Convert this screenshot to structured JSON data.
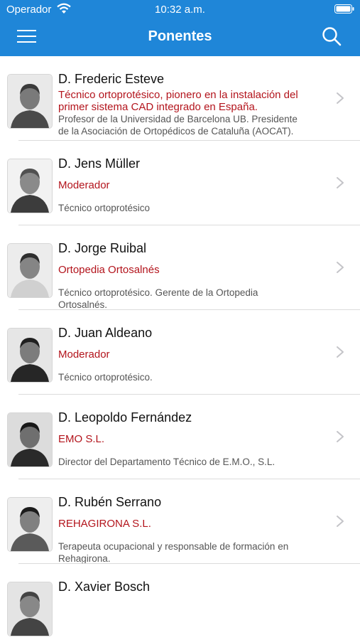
{
  "status_bar": {
    "carrier": "Operador",
    "time": "10:32 a.m."
  },
  "nav": {
    "title": "Ponentes"
  },
  "speakers": [
    {
      "name": "D. Frederic Esteve",
      "role_lines": [
        "Técnico ortoprotésico, pionero en la instalación del",
        "primer sistema CAD integrado en España."
      ],
      "desc_lines": [
        "Profesor de la Universidad de Barcelona UB. Presidente",
        "de la Asociación de Ortopédicos de Cataluña (AOCAT)."
      ]
    },
    {
      "name": "D. Jens Müller",
      "role_lines": [
        "Moderador"
      ],
      "desc_lines": [
        "Técnico ortoprotésico"
      ]
    },
    {
      "name": "D. Jorge Ruibal",
      "role_lines": [
        "Ortopedia Ortosalnés"
      ],
      "desc_lines": [
        "Técnico ortoprotésico. Gerente de la Ortopedia",
        "Ortosalnés."
      ]
    },
    {
      "name": "D. Juan Aldeano",
      "role_lines": [
        "Moderador"
      ],
      "desc_lines": [
        "Técnico ortoprotésico."
      ]
    },
    {
      "name": "D. Leopoldo Fernández",
      "role_lines": [
        "EMO S.L."
      ],
      "desc_lines": [
        "Director del Departamento Técnico de E.M.O., S.L."
      ]
    },
    {
      "name": "D. Rubén Serrano",
      "role_lines": [
        "REHAGIRONA S.L."
      ],
      "desc_lines": [
        "Terapeuta ocupacional y responsable de formación en",
        "Rehagirona."
      ]
    },
    {
      "name": "D. Xavier Bosch",
      "role_lines": [],
      "desc_lines": []
    }
  ],
  "colors": {
    "app_bar": "#1f86d8",
    "role_text": "#b3141c"
  },
  "icons": {
    "menu": "hamburger-icon",
    "search": "search-icon",
    "row_action": "chevron-right-icon"
  }
}
